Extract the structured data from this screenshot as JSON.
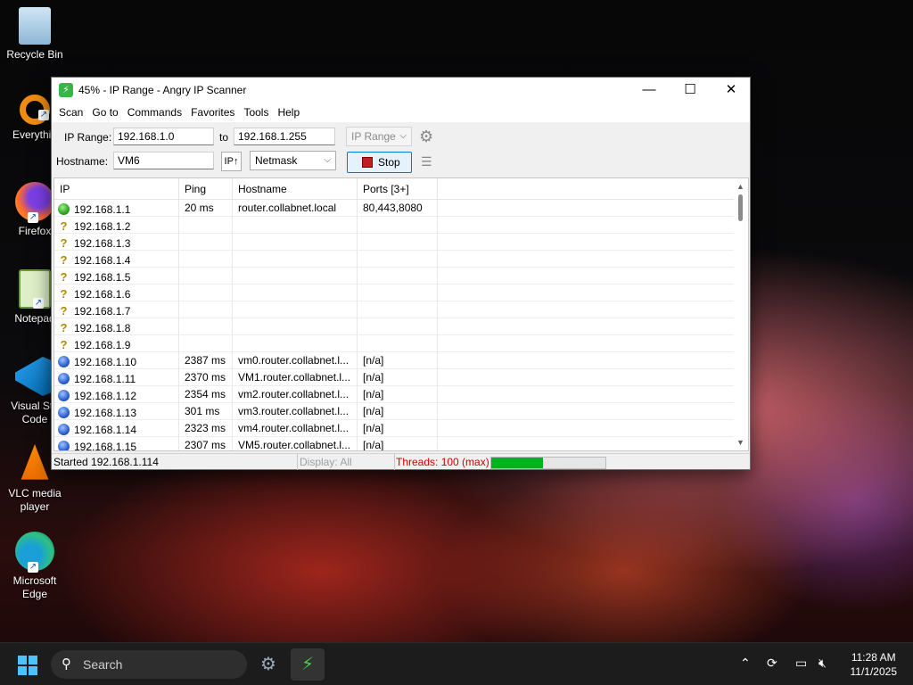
{
  "desktop": {
    "icons": [
      {
        "label": "Recycle Bin"
      },
      {
        "label": "Everythin"
      },
      {
        "label": "Firefox"
      },
      {
        "label": "Notepad"
      },
      {
        "label": "Visual Stu Code"
      },
      {
        "label": "VLC media player"
      },
      {
        "label": "Microsoft Edge"
      }
    ]
  },
  "window": {
    "title": "45% - IP Range - Angry IP Scanner",
    "controls": {
      "minimize": "—",
      "maximize": "☐",
      "close": "✕"
    }
  },
  "menu": [
    "Scan",
    "Go to",
    "Commands",
    "Favorites",
    "Tools",
    "Help"
  ],
  "toolbar": {
    "ip_range_label": "IP Range:",
    "ip_from": "192.168.1.0",
    "to_label": "to",
    "ip_to": "192.168.1.255",
    "feeder_select": "IP Range",
    "hostname_label": "Hostname:",
    "hostname_value": "VM6",
    "ip_button": "IP↑",
    "netmask_select": "Netmask",
    "stop_label": "Stop"
  },
  "table": {
    "columns": [
      "IP",
      "Ping",
      "Hostname",
      "Ports [3+]"
    ],
    "rows": [
      {
        "status": "alive",
        "ip": "192.168.1.1",
        "ping": "20 ms",
        "hostname": "router.collabnet.local",
        "ports": "80,443,8080"
      },
      {
        "status": "unknown",
        "ip": "192.168.1.2",
        "ping": "",
        "hostname": "",
        "ports": ""
      },
      {
        "status": "unknown",
        "ip": "192.168.1.3",
        "ping": "",
        "hostname": "",
        "ports": ""
      },
      {
        "status": "unknown",
        "ip": "192.168.1.4",
        "ping": "",
        "hostname": "",
        "ports": ""
      },
      {
        "status": "unknown",
        "ip": "192.168.1.5",
        "ping": "",
        "hostname": "",
        "ports": ""
      },
      {
        "status": "unknown",
        "ip": "192.168.1.6",
        "ping": "",
        "hostname": "",
        "ports": ""
      },
      {
        "status": "unknown",
        "ip": "192.168.1.7",
        "ping": "",
        "hostname": "",
        "ports": ""
      },
      {
        "status": "unknown",
        "ip": "192.168.1.8",
        "ping": "",
        "hostname": "",
        "ports": ""
      },
      {
        "status": "unknown",
        "ip": "192.168.1.9",
        "ping": "",
        "hostname": "",
        "ports": ""
      },
      {
        "status": "blue",
        "ip": "192.168.1.10",
        "ping": "2387 ms",
        "hostname": "vm0.router.collabnet.l...",
        "ports": "[n/a]"
      },
      {
        "status": "blue",
        "ip": "192.168.1.11",
        "ping": "2370 ms",
        "hostname": "VM1.router.collabnet.l...",
        "ports": "[n/a]"
      },
      {
        "status": "blue",
        "ip": "192.168.1.12",
        "ping": "2354 ms",
        "hostname": "vm2.router.collabnet.l...",
        "ports": "[n/a]"
      },
      {
        "status": "blue",
        "ip": "192.168.1.13",
        "ping": "301 ms",
        "hostname": "vm3.router.collabnet.l...",
        "ports": "[n/a]"
      },
      {
        "status": "blue",
        "ip": "192.168.1.14",
        "ping": "2323 ms",
        "hostname": "vm4.router.collabnet.l...",
        "ports": "[n/a]"
      },
      {
        "status": "blue",
        "ip": "192.168.1.15",
        "ping": "2307 ms",
        "hostname": "VM5.router.collabnet.l...",
        "ports": "[n/a]"
      }
    ]
  },
  "statusbar": {
    "started": "Started 192.168.1.114",
    "display": "Display: All",
    "threads": "Threads: 100 (max)",
    "progress": 0.45
  },
  "taskbar": {
    "search_placeholder": "Search",
    "time": "11:28 AM",
    "date": "11/1/2025"
  },
  "colors": {
    "accent": "#0078d7",
    "progress": "#06b025",
    "threads_text": "#d00000"
  }
}
